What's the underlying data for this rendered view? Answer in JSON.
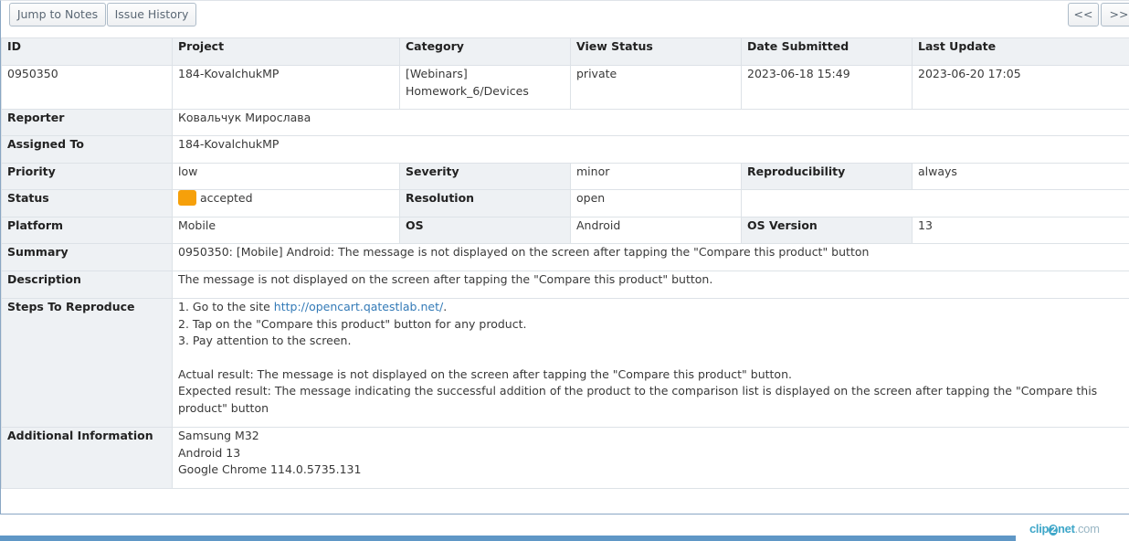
{
  "toolbar": {
    "jump_to_notes": "Jump to Notes",
    "issue_history": "Issue History",
    "prev": "<<",
    "next": ">>"
  },
  "headers": [
    "ID",
    "Project",
    "Category",
    "View Status",
    "Date Submitted",
    "Last Update"
  ],
  "issue": {
    "id": "0950350",
    "project": "184-KovalchukMP",
    "category_line1": "[Webinars]",
    "category_line2": "Homework_6/Devices",
    "view_status": "private",
    "date_submitted": "2023-06-18 15:49",
    "last_update": "2023-06-20 17:05"
  },
  "labels": {
    "reporter": "Reporter",
    "assigned_to": "Assigned To",
    "priority": "Priority",
    "severity": "Severity",
    "reproducibility": "Reproducibility",
    "status": "Status",
    "resolution": "Resolution",
    "platform": "Platform",
    "os": "OS",
    "os_version": "OS Version",
    "summary": "Summary",
    "description": "Description",
    "steps": "Steps To Reproduce",
    "additional": "Additional Information"
  },
  "values": {
    "reporter": "Ковальчук Мирослава",
    "assigned_to": "184-KovalchukMP",
    "priority": "low",
    "severity": "minor",
    "reproducibility": "always",
    "status": "accepted",
    "status_color": "#f6a00a",
    "resolution": "open",
    "platform": "Mobile",
    "os": "Android",
    "os_version": "13",
    "summary": "0950350: [Mobile] Android: The message is not displayed on the screen after tapping the \"Compare this product\" button",
    "description": "The message is not displayed on the screen after tapping the \"Compare this product\" button."
  },
  "steps": {
    "step1_prefix": "1. Go to the site ",
    "step1_link": "http://opencart.qatestlab.net/",
    "step1_suffix": ".",
    "step2": "2. Tap on the \"Compare this product\" button for any product.",
    "step3": "3. Pay attention to the screen.",
    "actual": "Actual result: The message is not displayed on the screen after tapping the \"Compare this product\" button.",
    "expected": "Expected result: The message indicating the successful addition of the product to the comparison list is displayed on the screen after tapping the \"Compare this product\" button"
  },
  "additional": {
    "line1": "Samsung M32",
    "line2": "Android 13",
    "line3": "Google Chrome 114.0.5735.131"
  },
  "watermark": {
    "part1": "clip",
    "part2": "2",
    "part3": "net",
    "part4": ".com"
  }
}
